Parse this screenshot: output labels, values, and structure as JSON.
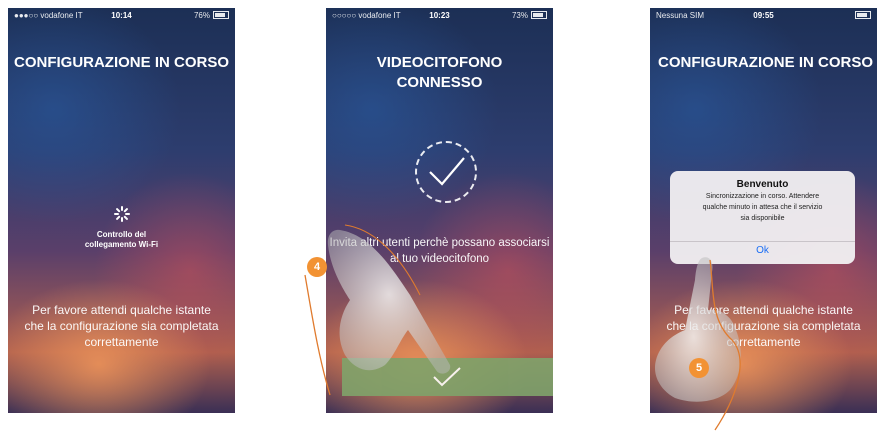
{
  "screen1": {
    "status": {
      "carrier": "●●●○○ vodafone IT",
      "time": "10:14",
      "battery": "76%"
    },
    "title": "CONFIGURAZIONE IN CORSO",
    "spinner_caption_line1": "Controllo del",
    "spinner_caption_line2": "collegamento Wi-Fi",
    "message_line1": "Per favore attendi qualche istante",
    "message_line2": "che la configurazione sia completata",
    "message_line3": "correttamente"
  },
  "screen2": {
    "status": {
      "carrier": "○○○○○ vodafone IT",
      "time": "10:23",
      "battery": "73%"
    },
    "title_line1": "VIDEOCITOFONO",
    "title_line2": "CONNESSO",
    "message_line1": "Invita altri utenti perchè possano associarsi",
    "message_line2": "al tuo videocitofono",
    "step": "4"
  },
  "screen3": {
    "status": {
      "carrier": "Nessuna SIM",
      "time": "09:55",
      "battery": ""
    },
    "title": "CONFIGURAZIONE IN CORSO",
    "dialog": {
      "title": "Benvenuto",
      "message_line1": "Sincronizzazione in corso. Attendere",
      "message_line2": "qualche minuto in attesa che il servizio",
      "message_line3": "sia disponibile",
      "ok_label": "Ok"
    },
    "bg_message_line1": "Per favore attendi qualche istante",
    "bg_message_line2": "che la configurazione sia completata",
    "bg_message_line3": "correttamente",
    "step": "5"
  },
  "colors": {
    "accent_orange": "#f29233",
    "confirm_green": "#7fa36a",
    "ios_blue": "#1a6ef5"
  }
}
